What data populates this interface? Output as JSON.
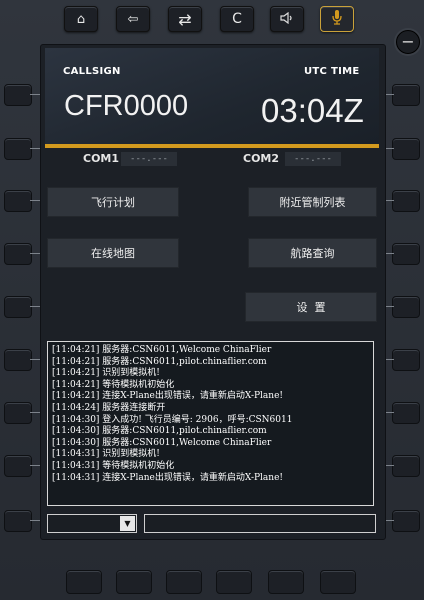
{
  "top_keys": [
    {
      "name": "home-button",
      "icon": "home-icon",
      "glyph": "⌂"
    },
    {
      "name": "back-button",
      "icon": "arrow-left-icon",
      "glyph": "⇦"
    },
    {
      "name": "swap-button",
      "icon": "swap-icon",
      "glyph": "⇄"
    },
    {
      "name": "clear-button",
      "icon": "clear-icon",
      "glyph": "C"
    },
    {
      "name": "volume-button",
      "icon": "speaker-icon",
      "glyph": "🔈"
    },
    {
      "name": "mic-button",
      "icon": "microphone-icon",
      "glyph": "🎙"
    }
  ],
  "header": {
    "callsign_label": "CALLSIGN",
    "callsign": "CFR0000",
    "utc_label": "UTC TIME",
    "utc_time": "03:04Z"
  },
  "com": {
    "com1_label": "COM1",
    "com1_value": "---.---",
    "com2_label": "COM2",
    "com2_value": "---.---"
  },
  "menu": {
    "flight_plan": "飞行计划",
    "nearby_atc": "附近管制列表",
    "online_map": "在线地图",
    "route_query": "航路查询",
    "settings": "设  置"
  },
  "log": [
    "[11:04:21] 服务器:CSN6011,Welcome ChinaFlier",
    "[11:04:21] 服务器:CSN6011,pilot.chinaflier.com",
    "[11:04:21] 识别到模拟机!",
    "[11:04:21] 等待模拟机初始化",
    "[11:04:21] 连接X-Plane出现错误，请重新启动X-Plane!",
    "[11:04:24] 服务器连接断开",
    "[11:04:30] 登入成功! 飞行员编号: 2906，呼号:CSN6011",
    "[11:04:30] 服务器:CSN6011,pilot.chinaflier.com",
    "[11:04:30] 服务器:CSN6011,Welcome ChinaFlier",
    "[11:04:31] 识别到模拟机!",
    "[11:04:31] 等待模拟机初始化",
    "[11:04:31] 连接X-Plane出现错误，请重新启动X-Plane!"
  ],
  "colors": {
    "accent": "#d39a1e",
    "mic_active": "#caa23a"
  }
}
